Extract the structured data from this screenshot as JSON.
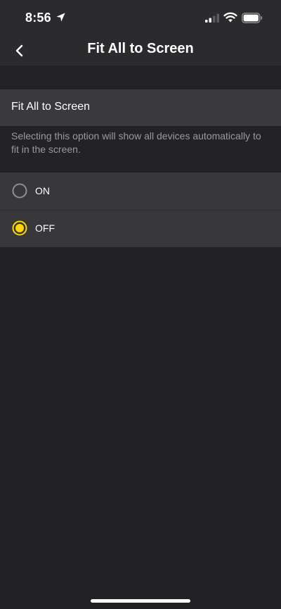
{
  "status_bar": {
    "time": "8:56"
  },
  "nav": {
    "title": "Fit All to Screen"
  },
  "section": {
    "title": "Fit All to Screen",
    "description": "Selecting this option will show all devices automatically to fit in the screen."
  },
  "options": [
    {
      "label": "ON",
      "selected": false
    },
    {
      "label": "OFF",
      "selected": true
    }
  ],
  "colors": {
    "accent": "#FFD600",
    "background": "#222224",
    "header_bg": "#2b2b2d",
    "section_bg": "#3a3a3d",
    "option_bg": "#38383b",
    "description_text": "#9a9a9e",
    "radio_off": "#8e8e93"
  },
  "icons": {
    "back": "chevron-left-icon",
    "location": "location-arrow-icon",
    "signal": "cellular-signal-icon",
    "wifi": "wifi-icon",
    "battery": "battery-icon"
  }
}
